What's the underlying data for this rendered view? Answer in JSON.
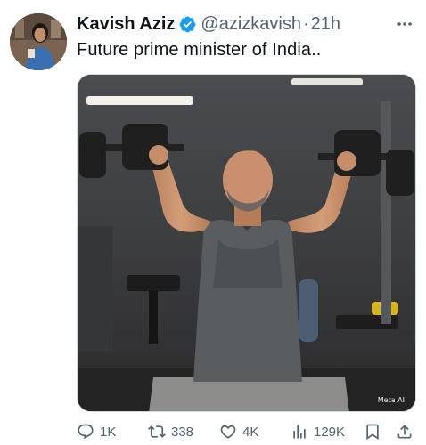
{
  "tweet": {
    "author": {
      "display_name": "Kavish Aziz",
      "handle": "@azizkavish",
      "verified": true,
      "verified_color": "#1d9bf0"
    },
    "separator": "·",
    "time": "21h",
    "text": "Future prime minister of India..",
    "media": {
      "watermark": "Meta AI"
    },
    "actions": {
      "replies": "1K",
      "reposts": "338",
      "likes": "4K",
      "views": "129K"
    },
    "icons": [
      "verified-badge-icon",
      "more-icon",
      "reply-icon",
      "repost-icon",
      "like-icon",
      "views-icon",
      "bookmark-icon",
      "share-icon"
    ]
  }
}
